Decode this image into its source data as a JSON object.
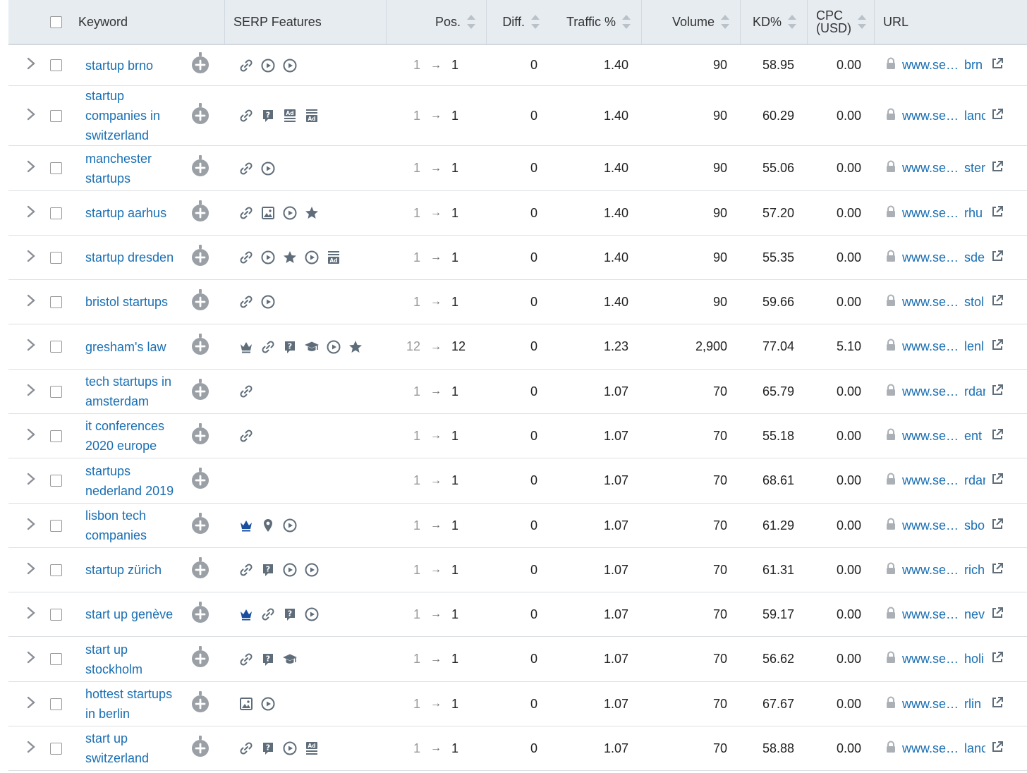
{
  "columns": {
    "keyword": "Keyword",
    "serp": "SERP Features",
    "pos": "Pos.",
    "diff": "Diff.",
    "traffic": "Traffic %",
    "volume": "Volume",
    "kd": "KD%",
    "cpc_line1": "CPC",
    "cpc_line2": "(USD)",
    "url": "URL"
  },
  "colors": {
    "link": "#1a6fb3",
    "header_bg": "#e7ecf1",
    "icon": "#5f6d7a",
    "crown": "#1a4fa0"
  },
  "rows": [
    {
      "keyword": [
        "startup brno"
      ],
      "features": [
        "link-icon",
        "video-icon",
        "video-icon"
      ],
      "pos_prev": "1",
      "pos": "1",
      "diff": "0",
      "traffic": "1.40",
      "volume": "90",
      "kd": "58.95",
      "cpc": "0.00",
      "url": "www.se…",
      "url_tail": "brn"
    },
    {
      "keyword": [
        "startup",
        "companies in",
        "switzerland"
      ],
      "features": [
        "link-icon",
        "faq-icon",
        "ad-top-icon",
        "ad-bottom-icon"
      ],
      "pos_prev": "1",
      "pos": "1",
      "diff": "0",
      "traffic": "1.40",
      "volume": "90",
      "kd": "60.29",
      "cpc": "0.00",
      "url": "www.se…",
      "url_tail": "lanc"
    },
    {
      "keyword": [
        "manchester",
        "startups"
      ],
      "features": [
        "link-icon",
        "video-icon"
      ],
      "pos_prev": "1",
      "pos": "1",
      "diff": "0",
      "traffic": "1.40",
      "volume": "90",
      "kd": "55.06",
      "cpc": "0.00",
      "url": "www.se…",
      "url_tail": "ster"
    },
    {
      "keyword": [
        "startup aarhus"
      ],
      "features": [
        "link-icon",
        "image-icon",
        "video-icon",
        "star-icon"
      ],
      "pos_prev": "1",
      "pos": "1",
      "diff": "0",
      "traffic": "1.40",
      "volume": "90",
      "kd": "57.20",
      "cpc": "0.00",
      "url": "www.se…",
      "url_tail": "rhu"
    },
    {
      "keyword": [
        "startup dresden"
      ],
      "features": [
        "link-icon",
        "video-icon",
        "star-icon",
        "video-icon",
        "ad-bottom-icon"
      ],
      "pos_prev": "1",
      "pos": "1",
      "diff": "0",
      "traffic": "1.40",
      "volume": "90",
      "kd": "55.35",
      "cpc": "0.00",
      "url": "www.se…",
      "url_tail": "sde"
    },
    {
      "keyword": [
        "bristol startups"
      ],
      "features": [
        "link-icon",
        "video-icon"
      ],
      "pos_prev": "1",
      "pos": "1",
      "diff": "0",
      "traffic": "1.40",
      "volume": "90",
      "kd": "59.66",
      "cpc": "0.00",
      "url": "www.se…",
      "url_tail": "stol"
    },
    {
      "keyword": [
        "gresham's law"
      ],
      "features": [
        "crown-icon",
        "link-icon",
        "faq-icon",
        "knowledge-icon",
        "video-icon",
        "star-icon"
      ],
      "pos_prev": "12",
      "pos": "12",
      "diff": "0",
      "traffic": "1.23",
      "volume": "2,900",
      "kd": "77.04",
      "cpc": "5.10",
      "url": "www.se…",
      "url_tail": "lenl"
    },
    {
      "keyword": [
        "tech startups in",
        "amsterdam"
      ],
      "features": [
        "link-icon"
      ],
      "pos_prev": "1",
      "pos": "1",
      "diff": "0",
      "traffic": "1.07",
      "volume": "70",
      "kd": "65.79",
      "cpc": "0.00",
      "url": "www.se…",
      "url_tail": "rdar"
    },
    {
      "keyword": [
        "it conferences",
        "2020 europe"
      ],
      "features": [
        "link-icon"
      ],
      "pos_prev": "1",
      "pos": "1",
      "diff": "0",
      "traffic": "1.07",
      "volume": "70",
      "kd": "55.18",
      "cpc": "0.00",
      "url": "www.se…",
      "url_tail": "ent"
    },
    {
      "keyword": [
        "startups",
        "nederland 2019"
      ],
      "features": [],
      "pos_prev": "1",
      "pos": "1",
      "diff": "0",
      "traffic": "1.07",
      "volume": "70",
      "kd": "68.61",
      "cpc": "0.00",
      "url": "www.se…",
      "url_tail": "rdar"
    },
    {
      "keyword": [
        "lisbon tech",
        "companies"
      ],
      "features": [
        "crown-blue-icon",
        "pin-icon",
        "video-icon"
      ],
      "pos_prev": "1",
      "pos": "1",
      "diff": "0",
      "traffic": "1.07",
      "volume": "70",
      "kd": "61.29",
      "cpc": "0.00",
      "url": "www.se…",
      "url_tail": "sbo"
    },
    {
      "keyword": [
        "startup zürich"
      ],
      "features": [
        "link-icon",
        "faq-icon",
        "video-icon",
        "video-icon"
      ],
      "pos_prev": "1",
      "pos": "1",
      "diff": "0",
      "traffic": "1.07",
      "volume": "70",
      "kd": "61.31",
      "cpc": "0.00",
      "url": "www.se…",
      "url_tail": "rich"
    },
    {
      "keyword": [
        "start up genève"
      ],
      "features": [
        "crown-blue-icon",
        "link-icon",
        "faq-icon",
        "video-icon"
      ],
      "pos_prev": "1",
      "pos": "1",
      "diff": "0",
      "traffic": "1.07",
      "volume": "70",
      "kd": "59.17",
      "cpc": "0.00",
      "url": "www.se…",
      "url_tail": "nev"
    },
    {
      "keyword": [
        "start up",
        "stockholm"
      ],
      "features": [
        "link-icon",
        "faq-icon",
        "knowledge-icon"
      ],
      "pos_prev": "1",
      "pos": "1",
      "diff": "0",
      "traffic": "1.07",
      "volume": "70",
      "kd": "56.62",
      "cpc": "0.00",
      "url": "www.se…",
      "url_tail": "holi"
    },
    {
      "keyword": [
        "hottest startups",
        "in berlin"
      ],
      "features": [
        "image-icon",
        "video-icon"
      ],
      "pos_prev": "1",
      "pos": "1",
      "diff": "0",
      "traffic": "1.07",
      "volume": "70",
      "kd": "67.67",
      "cpc": "0.00",
      "url": "www.se…",
      "url_tail": "rlin"
    },
    {
      "keyword": [
        "start up",
        "switzerland"
      ],
      "features": [
        "link-icon",
        "faq-icon",
        "video-icon",
        "ad-top-icon"
      ],
      "pos_prev": "1",
      "pos": "1",
      "diff": "0",
      "traffic": "1.07",
      "volume": "70",
      "kd": "58.88",
      "cpc": "0.00",
      "url": "www.se…",
      "url_tail": "lanc"
    }
  ]
}
